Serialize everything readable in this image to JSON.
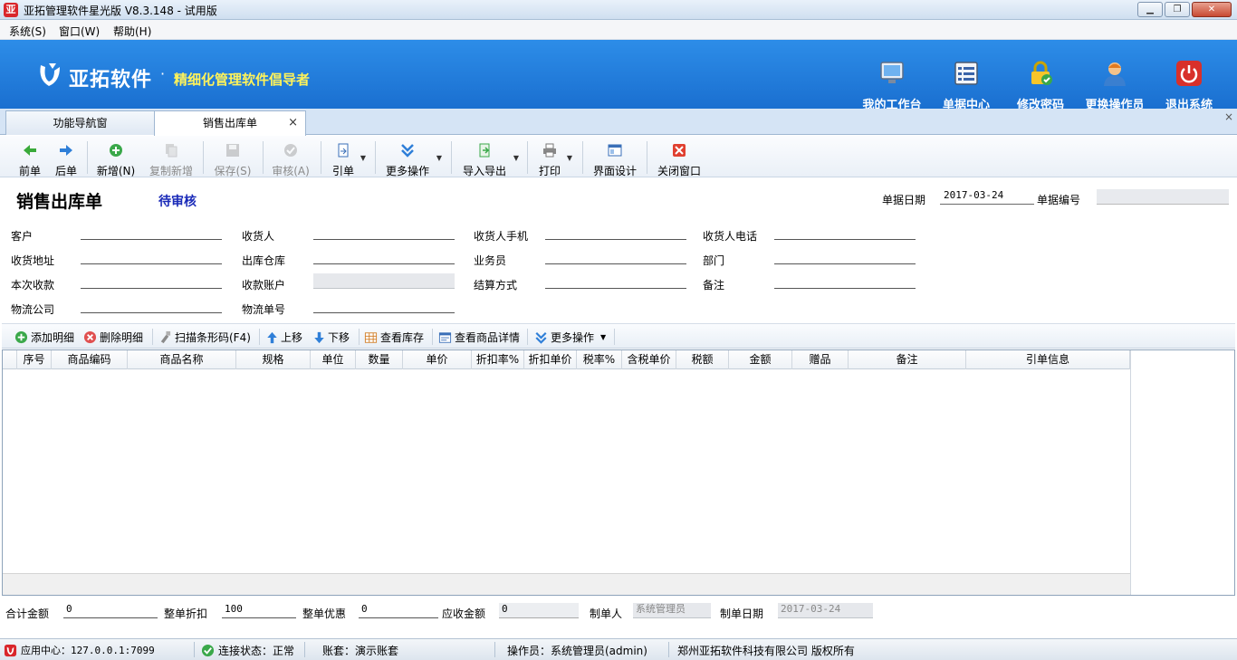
{
  "window": {
    "title": "亚拓管理软件星光版 V8.3.148 - 试用版"
  },
  "menu": [
    "系统(S)",
    "窗口(W)",
    "帮助(H)"
  ],
  "banner": {
    "brand": "亚拓软件",
    "dot": "·",
    "slogan": "精细化管理软件倡导者"
  },
  "topnav": [
    {
      "label": "我的工作台",
      "icon": "monitor-icon"
    },
    {
      "label": "单据中心",
      "icon": "document-list-icon"
    },
    {
      "label": "修改密码",
      "icon": "lock-icon"
    },
    {
      "label": "更换操作员",
      "icon": "user-icon"
    },
    {
      "label": "退出系统",
      "icon": "power-icon"
    }
  ],
  "tabs": [
    {
      "label": "功能导航窗"
    },
    {
      "label": "销售出库单",
      "close": "×"
    }
  ],
  "panel_close": "×",
  "toolbar": {
    "prev": "前单",
    "next": "后单",
    "new": "新增(N)",
    "copy_new": "复制新增",
    "save": "保存(S)",
    "audit": "审核(A)",
    "ref": "引单",
    "more": "更多操作",
    "import_export": "导入导出",
    "print": "打印",
    "ui_design": "界面设计",
    "close_window": "关闭窗口"
  },
  "doc": {
    "title": "销售出库单",
    "status": "待审核",
    "date_label": "单据日期",
    "date_value": "2017-03-24",
    "no_label": "单据编号",
    "no_value": ""
  },
  "form": {
    "customer": "客户",
    "receiver": "收货人",
    "receiver_mobile": "收货人手机",
    "receiver_phone": "收货人电话",
    "address": "收货地址",
    "warehouse": "出库仓库",
    "salesman": "业务员",
    "department": "部门",
    "receipt": "本次收款",
    "account": "收款账户",
    "settle": "结算方式",
    "remark": "备注",
    "logistics": "物流公司",
    "tracking": "物流单号"
  },
  "subtoolbar": {
    "add": "添加明细",
    "delete": "删除明细",
    "scan": "扫描条形码(F4)",
    "up": "上移",
    "down": "下移",
    "stock": "查看库存",
    "detail": "查看商品详情",
    "more": "更多操作"
  },
  "columns": [
    "序号",
    "商品编码",
    "商品名称",
    "规格",
    "单位",
    "数量",
    "单价",
    "折扣率%",
    "折扣单价",
    "税率%",
    "含税单价",
    "税额",
    "金额",
    "赠品",
    "备注",
    "引单信息"
  ],
  "footer": {
    "total_label": "合计金额",
    "total": "0",
    "discount_label": "整单折扣",
    "discount": "100",
    "offer_label": "整单优惠",
    "offer": "0",
    "receivable_label": "应收金额",
    "receivable": "0",
    "maker_label": "制单人",
    "maker": "系统管理员",
    "make_date_label": "制单日期",
    "make_date": "2017-03-24"
  },
  "statusbar": {
    "app_center": "应用中心：127.0.0.1:7099",
    "conn": "连接状态：正常",
    "account": "账套：演示账套",
    "operator": "操作员：系统管理员(admin)",
    "copyright": "郑州亚拓软件科技有限公司 版权所有"
  }
}
